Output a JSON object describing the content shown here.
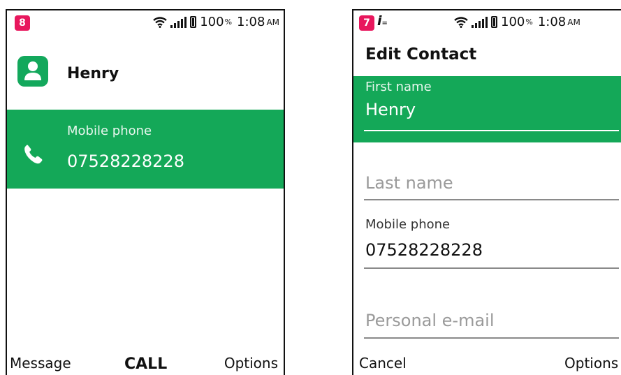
{
  "screen1": {
    "status": {
      "notification_count": "8",
      "battery": "100",
      "battery_unit": "%",
      "time": "1:08",
      "ampm": "AM"
    },
    "contact_name": "Henry",
    "phone": {
      "label": "Mobile phone",
      "number": "07528228228"
    },
    "softkeys": {
      "left": "Message",
      "center": "CALL",
      "right": "Options"
    }
  },
  "screen2": {
    "status": {
      "notification_count": "7",
      "input_mode": "i",
      "battery": "100",
      "battery_unit": "%",
      "time": "1:08",
      "ampm": "AM"
    },
    "title": "Edit Contact",
    "fields": {
      "first_name": {
        "label": "First name",
        "value": "Henry"
      },
      "last_name": {
        "placeholder": "Last name"
      },
      "mobile_phone": {
        "label": "Mobile phone",
        "value": "07528228228"
      },
      "email": {
        "placeholder": "Personal e-mail"
      }
    },
    "softkeys": {
      "left": "Cancel",
      "right": "Options"
    }
  },
  "colors": {
    "accent": "#14a858",
    "badge": "#e8175d"
  },
  "icons": [
    "wifi-icon",
    "signal-icon",
    "battery-icon",
    "contact-avatar-icon",
    "phone-icon"
  ]
}
